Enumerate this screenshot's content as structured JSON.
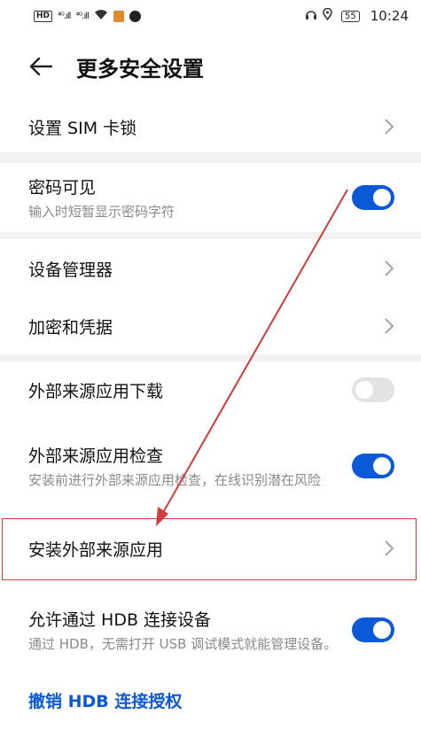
{
  "status_bar": {
    "hd": "HD",
    "sig1": "⁴ᴳ.ıll",
    "sig2": "⁴ᴳ.ıll",
    "battery": "55",
    "time": "10:24"
  },
  "header": {
    "title": "更多安全设置"
  },
  "settings": {
    "sim_lock": {
      "title": "设置 SIM 卡锁"
    },
    "password_visible": {
      "title": "密码可见",
      "subtitle": "输入时短暂显示密码字符",
      "enabled": true
    },
    "device_admin": {
      "title": "设备管理器"
    },
    "encryption": {
      "title": "加密和凭据"
    },
    "external_download": {
      "title": "外部来源应用下载",
      "enabled": false
    },
    "external_check": {
      "title": "外部来源应用检查",
      "subtitle": "安装前进行外部来源应用检查，在线识别潜在风险",
      "enabled": true
    },
    "install_external": {
      "title": "安装外部来源应用"
    },
    "allow_hdb": {
      "title": "允许通过 HDB 连接设备",
      "subtitle": "通过 HDB，无需打开 USB 调试模式就能管理设备。",
      "enabled": true
    },
    "revoke_hdb": {
      "title": "撤销 HDB 连接授权"
    }
  },
  "colors": {
    "accent": "#0a59d8",
    "annotation": "#d43c3c"
  }
}
